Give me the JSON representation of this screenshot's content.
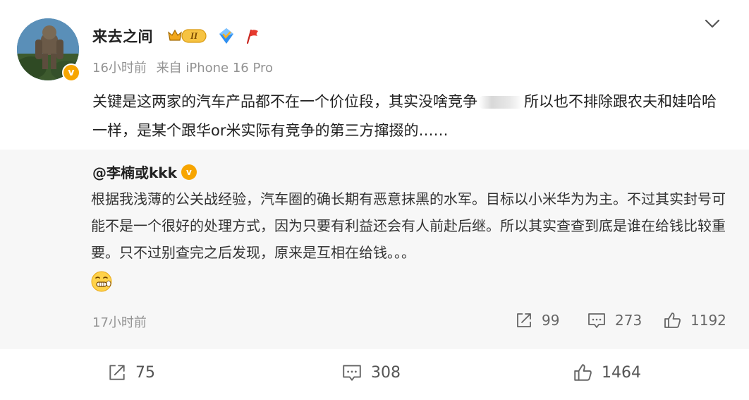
{
  "post": {
    "username": "来去之间",
    "level_badge": "II",
    "time": "16小时前",
    "source": "来自 iPhone 16 Pro",
    "text_part1": "关键是这两家的汽车产品都不在一个价位段，其实没啥竞争",
    "text_part2": "所以也不排除跟农夫和娃哈哈一样，是某个跟华or米实际有竞争的第三方撺掇的……",
    "avatar_badge": "v"
  },
  "repost": {
    "author": "@李楠或kkk",
    "author_badge": "v",
    "text": "根据我浅薄的公关战经验，汽车圈的确长期有恶意抹黑的水军。目标以小米华为为主。不过其实封号可能不是一个很好的处理方式，因为只要有利益还会有人前赴后继。所以其实查查到底是谁在给钱比较重要。只不过别查完之后发现，原来是互相在给钱。。。",
    "time": "17小时前",
    "shares": "99",
    "comments": "273",
    "likes": "1192"
  },
  "actions": {
    "shares": "75",
    "comments": "308",
    "likes": "1464"
  },
  "colors": {
    "badge_orange": "#f7a500",
    "meta_gray": "#939393",
    "repost_bg": "#f7f7f7"
  },
  "icons": [
    "chevron-down-icon",
    "crown-badge-icon",
    "blue-diamond-icon",
    "red-flag-icon",
    "share-icon",
    "comment-icon",
    "like-icon",
    "grimace-emoji-icon"
  ]
}
